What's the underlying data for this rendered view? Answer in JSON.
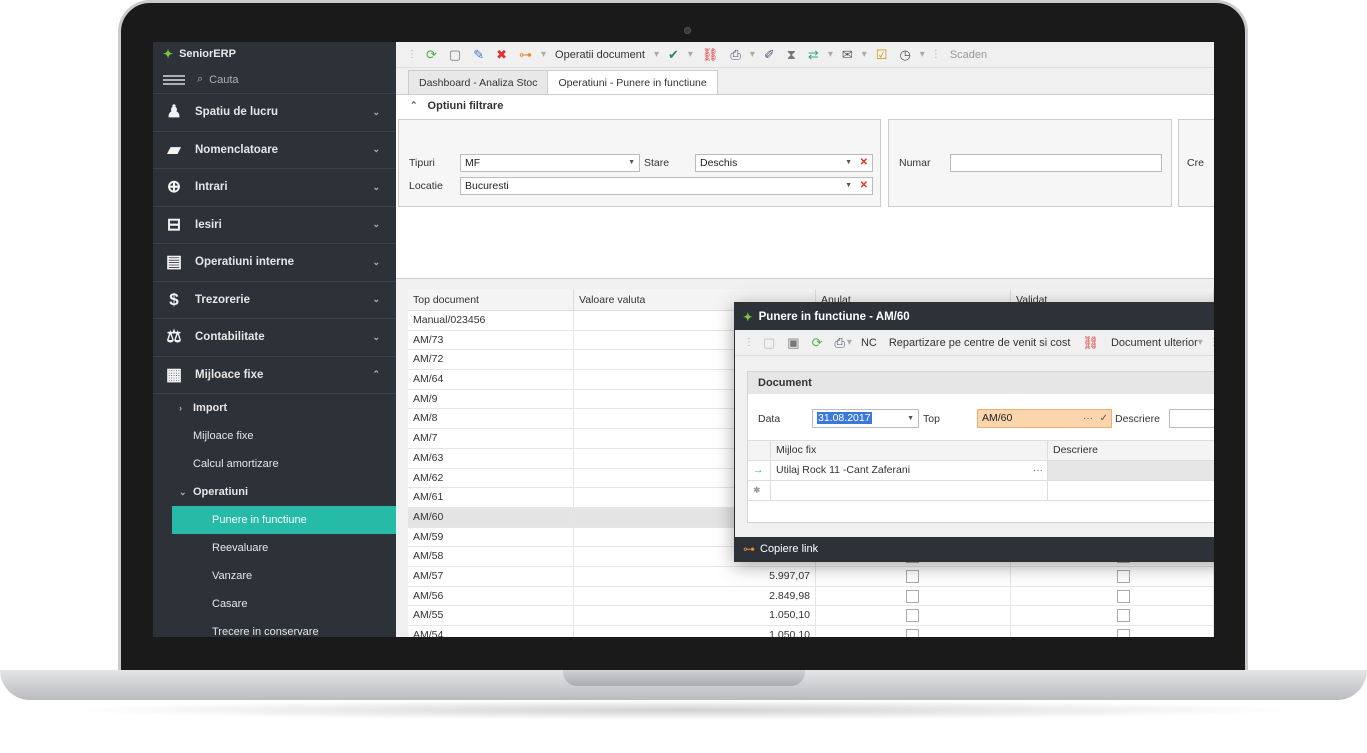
{
  "app": {
    "brand": "SeniorERP",
    "search_placeholder": "Cauta",
    "accent_color": "#26bba6",
    "brand_color": "#7ec242"
  },
  "sidebar": {
    "items": [
      {
        "label": "Spatiu de lucru",
        "icon": "person-desk-icon"
      },
      {
        "label": "Nomenclatoare",
        "icon": "folder-open-icon"
      },
      {
        "label": "Intrari",
        "icon": "cart-plus-icon"
      },
      {
        "label": "Iesiri",
        "icon": "cart-icon"
      },
      {
        "label": "Operatiuni interne",
        "icon": "clipboard-icon"
      },
      {
        "label": "Trezorerie",
        "icon": "coins-icon"
      },
      {
        "label": "Contabilitate",
        "icon": "scales-icon"
      },
      {
        "label": "Mijloace fixe",
        "icon": "building-icon"
      }
    ],
    "submenu": {
      "import": "Import",
      "mijloace_fixe": "Mijloace fixe",
      "calcul_amortizare": "Calcul amortizare",
      "operatiuni": "Operatiuni",
      "punere_in_functiune": "Punere in functiune",
      "reevaluare": "Reevaluare",
      "vanzare": "Vanzare",
      "casare": "Casare",
      "trecere": "Trecere in conservare"
    }
  },
  "toolbar": {
    "operatii_document": "Operatii document",
    "scadente": "Scaden"
  },
  "tabs": [
    {
      "label": "Dashboard - Analiza Stoc",
      "active": false
    },
    {
      "label": "Operatiuni - Punere in functiune",
      "active": true
    }
  ],
  "filters": {
    "title": "Optiuni filtrare",
    "tipuri_label": "Tipuri",
    "tipuri_value": "MF",
    "stare_label": "Stare",
    "stare_value": "Deschis",
    "locatie_label": "Locatie",
    "locatie_value": "Bucuresti",
    "numar_label": "Numar",
    "numar_value": "",
    "cut_label": "Cre"
  },
  "grid": {
    "columns": [
      "Top document",
      "Valoare valuta",
      "Anulat",
      "Validat"
    ],
    "rows": [
      {
        "top": "Manual/023456",
        "valoare": ""
      },
      {
        "top": "AM/73",
        "valoare": ""
      },
      {
        "top": "AM/72",
        "valoare": ""
      },
      {
        "top": "AM/64",
        "valoare": ""
      },
      {
        "top": "AM/9",
        "valoare": ""
      },
      {
        "top": "AM/8",
        "valoare": ""
      },
      {
        "top": "AM/7",
        "valoare": ""
      },
      {
        "top": "AM/63",
        "valoare": ""
      },
      {
        "top": "AM/62",
        "valoare": ""
      },
      {
        "top": "AM/61",
        "valoare": ""
      },
      {
        "top": "AM/60",
        "valoare": ""
      },
      {
        "top": "AM/59",
        "valoare": ""
      },
      {
        "top": "AM/58",
        "valoare": ""
      },
      {
        "top": "AM/57",
        "valoare": "5.997,07"
      },
      {
        "top": "AM/56",
        "valoare": "2.849,98"
      },
      {
        "top": "AM/55",
        "valoare": "1.050,10"
      },
      {
        "top": "AM/54",
        "valoare": "1.050,10"
      }
    ]
  },
  "dialog": {
    "title": "Punere in functiune - AM/60",
    "toolbar": {
      "nc": "NC",
      "repartizare": "Repartizare pe centre de venit si cost",
      "document_ulterior": "Document ulterior"
    },
    "section_title": "Document",
    "data_label": "Data",
    "data_value": "31.08.2017",
    "top_label": "Top",
    "top_value": "AM/60",
    "descriere_label": "Descriere",
    "descriere_value": "",
    "subgrid_columns": [
      "Mijloc fix",
      "Descriere"
    ],
    "subgrid_row": "Utilaj Rock 11 -Cant Zaferani",
    "footer_link": "Copiere link"
  }
}
